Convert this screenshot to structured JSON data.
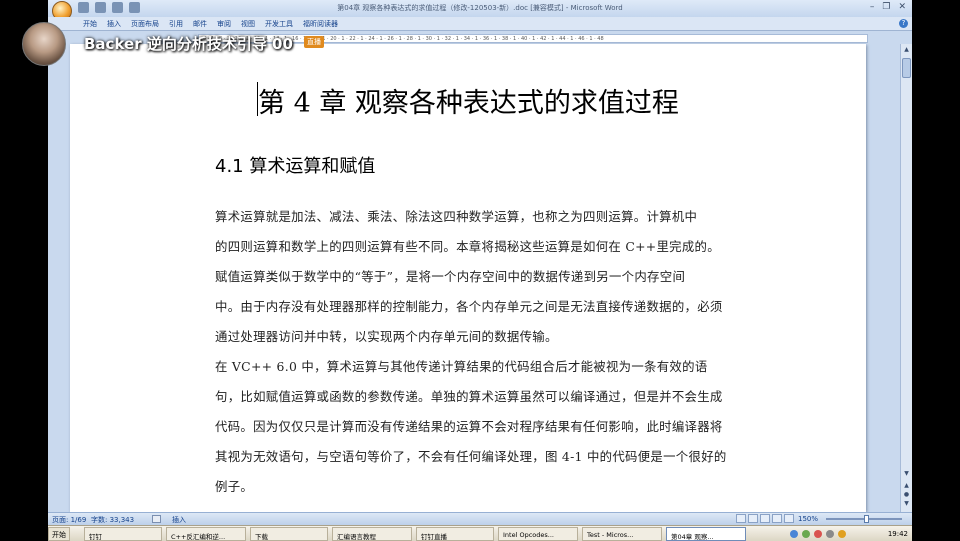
{
  "window": {
    "title": "第04章 观察各种表达式的求值过程（修改-120503-新）.doc [兼容模式] - Microsoft Word",
    "controls": [
      "–",
      "❐",
      "✕"
    ]
  },
  "ribbon": {
    "tabs": [
      "开始",
      "插入",
      "页面布局",
      "引用",
      "邮件",
      "审阅",
      "视图",
      "开发工具",
      "福昕阅读器"
    ]
  },
  "ruler": {
    "text": "6 · 1 · 8 · 1 · 10 · 1 · 12 · 1 · 14 · 1 · 16 · 1 · 18 · 1 · 20 · 1 · 22 · 1 · 24 · 1 · 26 · 1 · 28 · 1 · 30 · 1 · 32 · 1 · 34 · 1 · 36 · 1 · 38 · 1 · 40 · 1 · 42 · 1 · 44 · 1 · 46 · 1 · 48"
  },
  "overlay": {
    "title": "Backer 逆向分析技术引导 00",
    "badge": "直播"
  },
  "document": {
    "chapter_title": "第 4 章  观察各种表达式的求值过程",
    "section_title": "4.1 算术运算和赋值",
    "lines": [
      "    算术运算就是加法、减法、乘法、除法这四种数学运算，也称之为四则运算。计算机中",
      "的四则运算和数学上的四则运算有些不同。本章将揭秘这些运算是如何在 C++里完成的。",
      "    赋值运算类似于数学中的“等于”，是将一个内存空间中的数据传递到另一个内存空间",
      "中。由于内存没有处理器那样的控制能力，各个内存单元之间是无法直接传递数据的，必须",
      "通过处理器访问并中转，以实现两个内存单元间的数据传输。",
      "    在 VC++ 6.0 中，算术运算与其他传递计算结果的代码组合后才能被视为一条有效的语",
      "句，比如赋值运算或函数的参数传递。单独的算术运算虽然可以编译通过，但是并不会生成",
      "代码。因为仅仅只是计算而没有传递结果的运算不会对程序结果有任何影响，此时编译器将",
      "其视为无效语句，与空语句等价了，不会有任何编译处理，图 4-1 中的代码便是一个很好的",
      "例子。"
    ]
  },
  "statusbar": {
    "page": "页面: 1/69",
    "words": "字数: 33,343",
    "insert": "插入",
    "zoom": "150%"
  },
  "taskbar": {
    "start": "开始",
    "buttons": [
      "钉钉",
      "C++反汇编和逆...",
      "下载",
      "汇编语言教程",
      "钉钉直播",
      "Intel Opcodes...",
      "Test - Micros...",
      "第04章 观察..."
    ],
    "clock": "19:42"
  }
}
